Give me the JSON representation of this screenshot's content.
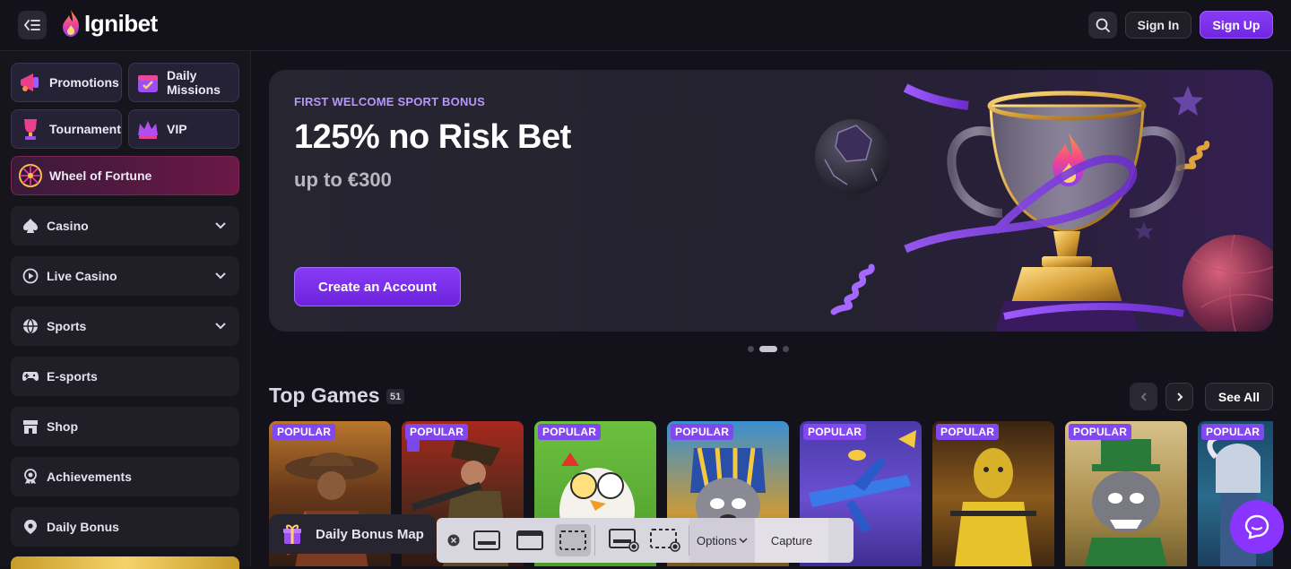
{
  "header": {
    "logo_text": "Ignibet",
    "signin_label": "Sign In",
    "signup_label": "Sign Up",
    "accent_color": "#7b2ff0"
  },
  "sidebar": {
    "tiles": [
      {
        "label": "Promotions",
        "icon": "megaphone-icon"
      },
      {
        "label": "Daily Missions",
        "icon": "calendar-icon"
      },
      {
        "label": "Tournament",
        "icon": "trophy-icon"
      },
      {
        "label": "VIP",
        "icon": "crown-icon"
      },
      {
        "label": "Wheel of Fortune",
        "icon": "wheel-icon"
      }
    ],
    "items": [
      {
        "label": "Casino",
        "icon": "spade-icon",
        "expandable": true
      },
      {
        "label": "Live Casino",
        "icon": "play-circle-icon",
        "expandable": true
      },
      {
        "label": "Sports",
        "icon": "ball-icon",
        "expandable": true
      },
      {
        "label": "E-sports",
        "icon": "gamepad-icon",
        "expandable": false
      },
      {
        "label": "Shop",
        "icon": "store-icon",
        "expandable": false
      },
      {
        "label": "Achievements",
        "icon": "medal-icon",
        "expandable": false
      },
      {
        "label": "Daily Bonus",
        "icon": "location-pin-icon",
        "expandable": false
      }
    ]
  },
  "banner": {
    "subtitle": "FIRST WELCOME SPORT BONUS",
    "title": "125% no Risk Bet",
    "amount": "up to €300",
    "cta_label": "Create an Account",
    "slide_count": 3,
    "active_slide": 2
  },
  "top_games": {
    "title": "Top Games",
    "count": "51",
    "see_all_label": "See All",
    "games": [
      {
        "badge": "POPULAR",
        "theme": "cowboy"
      },
      {
        "badge": "POPULAR",
        "theme": "gunman"
      },
      {
        "badge": "POPULAR",
        "theme": "chicken"
      },
      {
        "badge": "POPULAR",
        "theme": "raccoon-pharaoh"
      },
      {
        "badge": "POPULAR",
        "theme": "airplane"
      },
      {
        "badge": "POPULAR",
        "theme": "prisoner"
      },
      {
        "badge": "POPULAR",
        "theme": "raccoon-leprechaun"
      },
      {
        "badge": "POPULAR",
        "theme": "viking"
      }
    ]
  },
  "bonus_map": {
    "label": "Daily Bonus Map"
  },
  "screenshot_toolbar": {
    "options_label": "Options",
    "capture_label": "Capture"
  }
}
